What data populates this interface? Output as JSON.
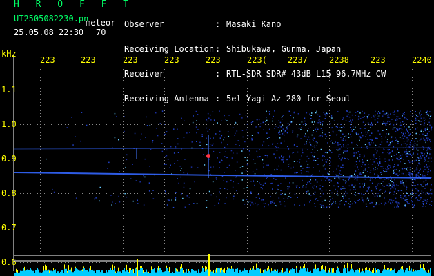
{
  "app": {
    "title": "H R O F F T",
    "filename": "UT2505082230.pn",
    "tag": "meteor",
    "datetime": "25.05.08 22:30",
    "count": "70"
  },
  "header": {
    "labels": [
      "Observer",
      "Receiving Location",
      "Receiver",
      "Receiving Antenna"
    ],
    "colons": [
      ":",
      ":",
      ":",
      ":"
    ],
    "values": [
      "Masaki Kano",
      "Shibukawa, Gunma, Japan",
      "RTL-SDR SDR# 43dB L15 96.7MHz CW",
      "5el Yagi Az 280 for Seoul"
    ]
  },
  "axes": {
    "y_unit": "kHz",
    "y_ticks": [
      "1.1",
      "1.0",
      "0.9",
      "0.8",
      "0.7",
      "0.6"
    ],
    "x_ticks": [
      "223",
      "223",
      "223",
      "223",
      "223",
      "223(",
      "2237",
      "2238",
      "223",
      "2240"
    ]
  },
  "colors": {
    "background": "#000000",
    "title": "#00ff66",
    "text": "#ffffff",
    "tick": "#ffff00",
    "grid": "#ffffff",
    "signal": "#3366ff",
    "level_trace": "#ffff00",
    "level_fill": "#00ccff"
  }
}
